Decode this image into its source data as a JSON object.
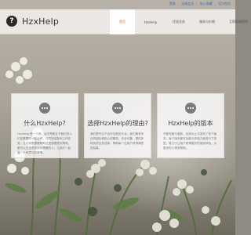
{
  "top_links": [
    "登录",
    "注册会员",
    "加入收藏",
    "设为首页"
  ],
  "brand": {
    "icon_glyph": "?",
    "name": "HzxHelp"
  },
  "nav": {
    "items": [
      {
        "label": "首页",
        "active": true
      },
      {
        "label": "HzxHelp",
        "active": false
      },
      {
        "label": "优选业务",
        "active": false
      },
      {
        "label": "服务与价格",
        "active": false
      },
      {
        "label": "互帮客服帮找",
        "active": false
      }
    ]
  },
  "cards": [
    {
      "title": "什么HzxHelp?",
      "text": "HzxHelp 是一个网，旨在帮助互不相识的人们在需要时一起合作，共同完成各种工作任务。无论你是需要帮助还是想要提供帮助，都可以在这里找到你需要的人，让我们一起做一个有意义的事情。"
    },
    {
      "title": "选择HzxHelp的理由?",
      "text": "我们是专注于合作互助的平台，我们拥有专业的团队和贴心的服务，安全可靠，提供多种优质业务选择，帮助每一位用户获得满意的结果。"
    },
    {
      "title": "HzxHelp的版本",
      "text": "不断完善与更新，目前为止共发布了多个版本。每个版本都在功能与体验方面进行了改进，致力于让用户获得更好的使用体验，为更多的人带来帮助。"
    }
  ]
}
